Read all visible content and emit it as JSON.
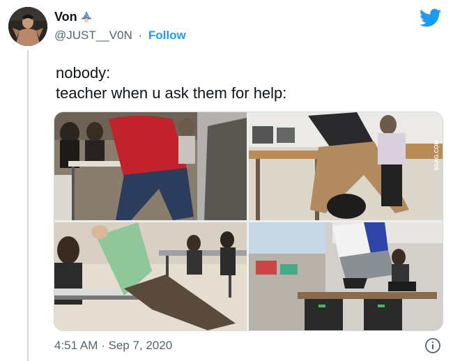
{
  "tweet": {
    "display_name": "Von",
    "handle": "@JUST__V0N",
    "separator": "·",
    "follow_label": "Follow",
    "text_lines": [
      "nobody:",
      "teacher when u ask them for help:"
    ],
    "timestamp": "4:51 AM · Sep 7, 2020"
  },
  "media": {
    "watermark": "9GAG.COM"
  },
  "icons": {
    "brand": "twitter-bird-icon",
    "badge": "wizard-emoji-icon",
    "info": "info-icon"
  },
  "colors": {
    "accent": "#1d9bf0",
    "secondary_text": "#536471",
    "border": "#cfd9de"
  }
}
